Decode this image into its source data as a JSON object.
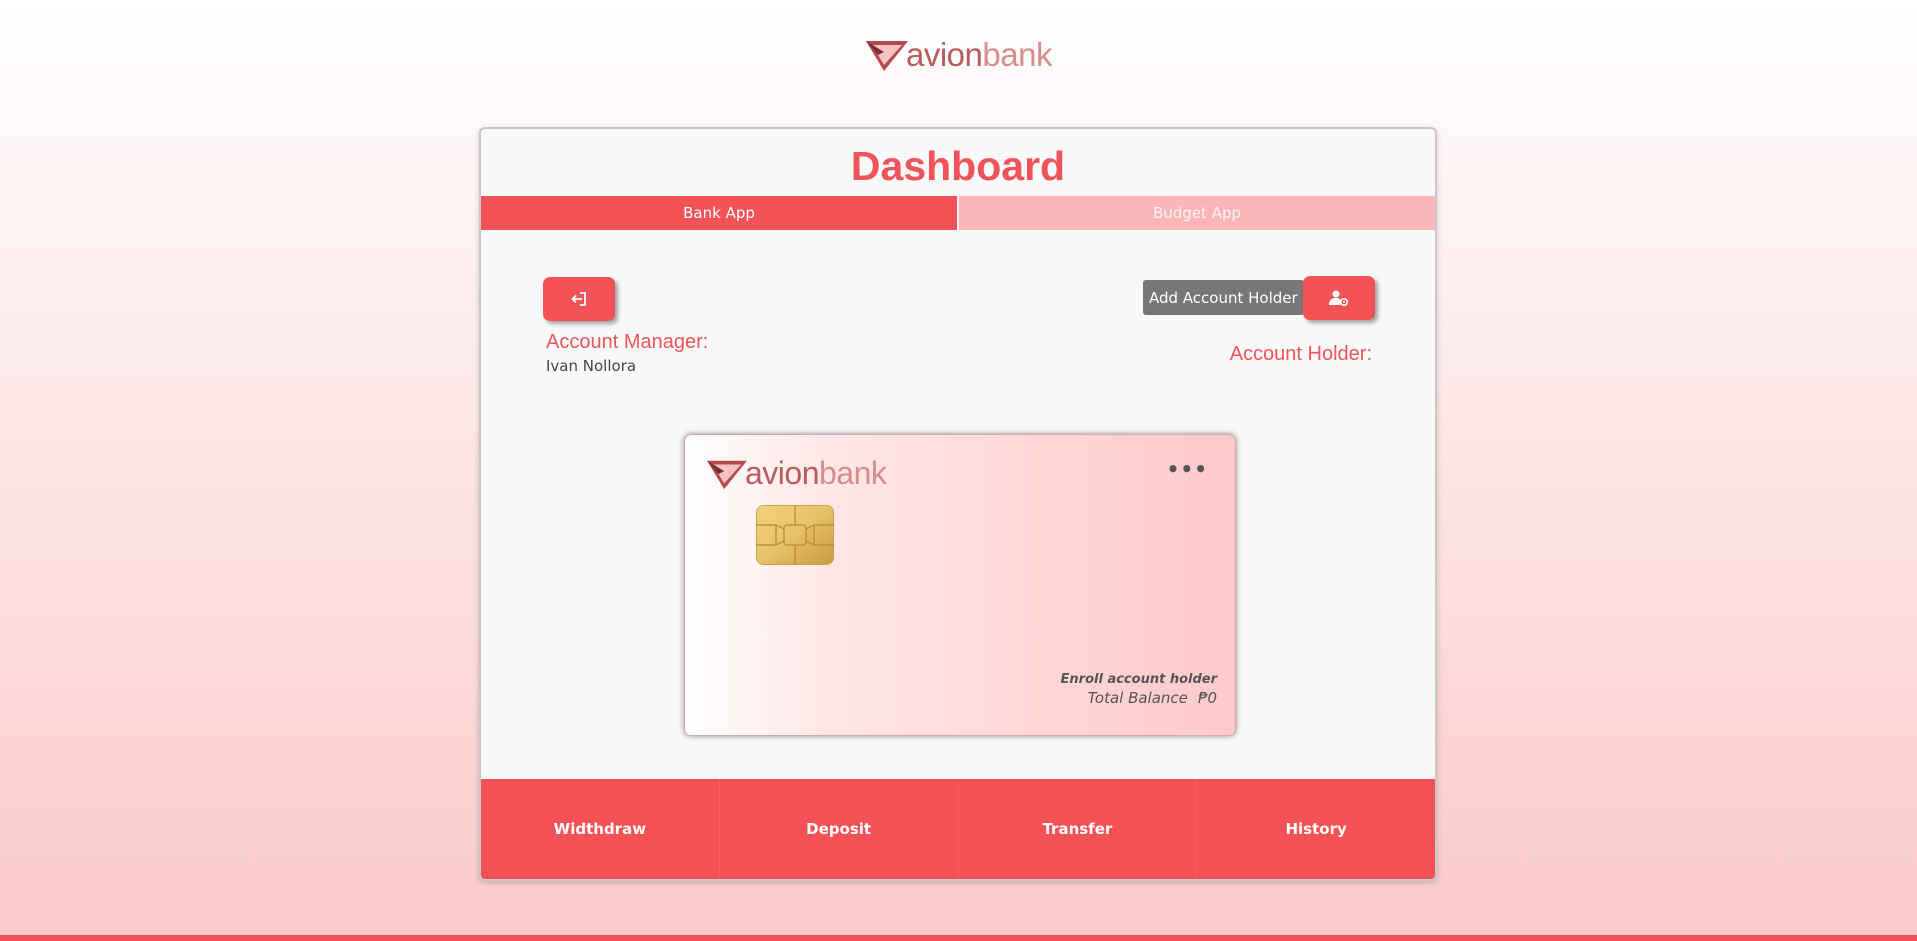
{
  "brand": {
    "name_part1": "avion",
    "name_part2": "bank"
  },
  "page": {
    "title": "Dashboard"
  },
  "tabs": [
    {
      "label": "Bank App",
      "active": true
    },
    {
      "label": "Budget App",
      "active": false
    }
  ],
  "toolbar": {
    "add_account_holder_label": "Add Account Holder"
  },
  "account_manager": {
    "label": "Account Manager:",
    "name": "Ivan Nollora"
  },
  "account_holder": {
    "label": "Account Holder:"
  },
  "card": {
    "menu_label": "•••",
    "status": "Enroll account holder",
    "balance_label": "Total Balance",
    "balance_value": "₱0"
  },
  "actions": [
    {
      "label": "Widthdraw"
    },
    {
      "label": "Deposit"
    },
    {
      "label": "Transfer"
    },
    {
      "label": "History"
    }
  ],
  "icons": {
    "logout": "logout-icon",
    "add_user": "user-gear-icon",
    "logo": "paper-plane-icon"
  },
  "colors": {
    "accent": "#f45257",
    "tab_inactive": "#fdb6b7",
    "gray_button": "#777777"
  }
}
